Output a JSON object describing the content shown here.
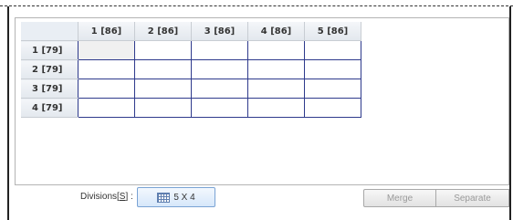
{
  "grid": {
    "columns": [
      "1 [86]",
      "2 [86]",
      "3 [86]",
      "4 [86]",
      "5 [86]"
    ],
    "rows": [
      "1 [79]",
      "2 [79]",
      "3 [79]",
      "4 [79]"
    ]
  },
  "divisions": {
    "label_prefix": "Divisions[",
    "label_key": "S",
    "label_suffix": "] :",
    "button_label": "5 X 4",
    "button_icon": "table-grid-icon"
  },
  "actions": {
    "merge_label": "Merge",
    "separate_label": "Separate",
    "disabled_text_color": "#9a9a9a"
  },
  "colors": {
    "cell_border": "#2e3a8c",
    "header_bg": "#e3e8ee",
    "button_border": "#7aa3d4"
  }
}
